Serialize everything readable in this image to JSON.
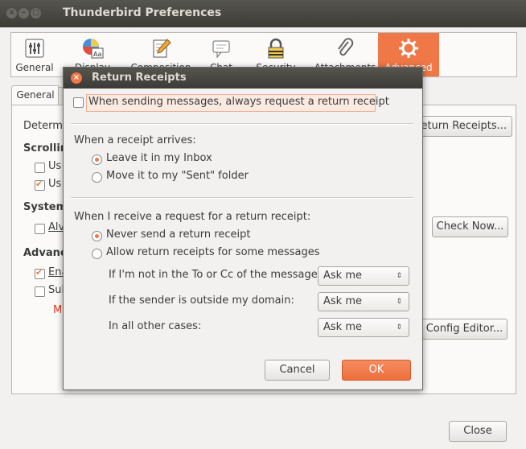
{
  "window": {
    "title": "Thunderbird Preferences"
  },
  "toolbar": {
    "items": [
      {
        "label": "General",
        "icon": "sliders-icon"
      },
      {
        "label": "Display",
        "icon": "display-icon"
      },
      {
        "label": "Composition",
        "icon": "pencil-icon"
      },
      {
        "label": "Chat",
        "icon": "chat-icon"
      },
      {
        "label": "Security",
        "icon": "lock-icon"
      },
      {
        "label": "Attachments",
        "icon": "paperclip-icon"
      },
      {
        "label": "Advanced",
        "icon": "gear-icon"
      }
    ],
    "active_color": "#f07746"
  },
  "background": {
    "tab_general": "General",
    "determ": "Determ",
    "scrolling": "Scrollin",
    "us1": "Us",
    "us2": "Us",
    "system": "System",
    "alv": "Alv",
    "advanced": "Advanc",
    "ena": "Ena",
    "sul": "Sul",
    "m": "M",
    "receipts_button": "Return Receipts...",
    "receipts_visible": "eturn Receipts...",
    "check_now": "Check Now...",
    "config_editor": "Config Editor...",
    "close": "Close"
  },
  "dialog": {
    "title": "Return Receipts",
    "always_request": "When sending messages, always request a return receipt",
    "when_arrives": "When a receipt arrives:",
    "leave_inbox": "Leave it in my Inbox",
    "move_sent": "Move it to my \"Sent\" folder",
    "when_request": "When I receive a request for a return receipt:",
    "never_send": "Never send a return receipt",
    "allow_some": "Allow return receipts for some messages",
    "not_in_to": "If I'm not in the To or Cc of the message:",
    "outside_domain": "If the sender is outside my domain:",
    "other_cases": "In all other cases:",
    "select_value_1": "Ask me",
    "select_value_2": "Ask me",
    "select_value_3": "Ask me",
    "cancel": "Cancel",
    "ok": "OK"
  }
}
